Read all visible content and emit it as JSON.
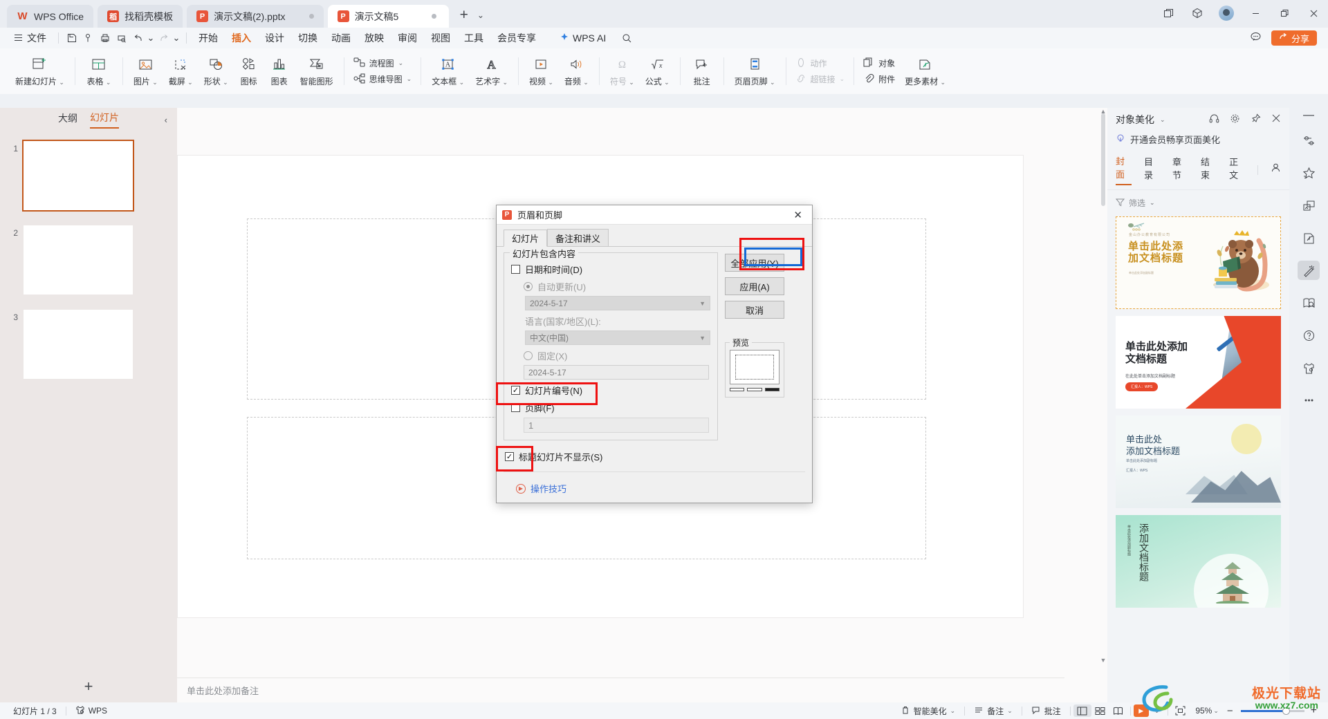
{
  "window": {
    "tabs": [
      {
        "label": "WPS Office",
        "icon": "wps-logo-icon",
        "type": "home"
      },
      {
        "label": "找稻壳模板",
        "icon": "docer-icon",
        "type": "chip"
      },
      {
        "label": "演示文稿(2).pptx",
        "icon": "ppt-icon",
        "type": "chip",
        "modified_dot": true
      },
      {
        "label": "演示文稿5",
        "icon": "ppt-icon",
        "type": "active"
      }
    ],
    "new_tab_icon": "plus-icon",
    "tab_list_icon": "chevron-down-icon",
    "right_icons": [
      "multi-window-icon",
      "cube-icon",
      "avatar"
    ],
    "controls": [
      "minimize-icon",
      "restore-icon",
      "close-icon"
    ]
  },
  "menubar": {
    "file_label": "文件",
    "file_icon": "hamburger-icon",
    "quick_icons": [
      "save-icon",
      "cloud-save-icon",
      "print-icon",
      "print-preview-icon",
      "undo-icon",
      "undo-caret",
      "redo-icon",
      "customize-caret"
    ],
    "items": [
      {
        "label": "开始",
        "active": false
      },
      {
        "label": "插入",
        "active": true
      },
      {
        "label": "设计",
        "active": false
      },
      {
        "label": "切换",
        "active": false
      },
      {
        "label": "动画",
        "active": false
      },
      {
        "label": "放映",
        "active": false
      },
      {
        "label": "审阅",
        "active": false
      },
      {
        "label": "视图",
        "active": false
      },
      {
        "label": "工具",
        "active": false
      },
      {
        "label": "会员专享",
        "active": false
      }
    ],
    "ai_label": "WPS AI",
    "ai_icon": "sparkle-icon",
    "search_icon": "search-icon",
    "feedback_icon": "chat-icon",
    "share_label": "分享",
    "share_icon": "share-icon"
  },
  "ribbon": {
    "groups": [
      {
        "items": [
          {
            "label": "新建幻灯片",
            "icon": "new-slide-icon",
            "caret": true
          }
        ]
      },
      {
        "items": [
          {
            "label": "表格",
            "icon": "table-icon",
            "caret": true
          }
        ]
      },
      {
        "items": [
          {
            "label": "图片",
            "icon": "picture-icon",
            "caret": true
          },
          {
            "label": "截屏",
            "icon": "screenshot-icon",
            "caret": true
          },
          {
            "label": "形状",
            "icon": "shapes-icon",
            "caret": true
          },
          {
            "label": "图标",
            "icon": "icons-icon",
            "caret": false
          },
          {
            "label": "图表",
            "icon": "chart-icon",
            "caret": false
          },
          {
            "label": "智能图形",
            "icon": "smartart-icon",
            "caret": false
          }
        ]
      },
      {
        "stack": [
          {
            "label": "流程图",
            "icon": "flowchart-icon",
            "caret": true
          },
          {
            "label": "思维导图",
            "icon": "mindmap-icon",
            "caret": true
          }
        ]
      },
      {
        "items": [
          {
            "label": "文本框",
            "icon": "textbox-icon",
            "caret": true
          },
          {
            "label": "艺术字",
            "icon": "wordart-icon",
            "caret": true
          }
        ]
      },
      {
        "items": [
          {
            "label": "视频",
            "icon": "video-icon",
            "caret": true
          },
          {
            "label": "音频",
            "icon": "audio-icon",
            "caret": true
          }
        ]
      },
      {
        "items": [
          {
            "label": "符号",
            "icon": "symbol-icon",
            "caret": true,
            "disabled": true
          },
          {
            "label": "公式",
            "icon": "formula-icon",
            "caret": true
          }
        ]
      },
      {
        "items": [
          {
            "label": "批注",
            "icon": "comment-icon",
            "caret": false
          }
        ]
      },
      {
        "items": [
          {
            "label": "页眉页脚",
            "icon": "header-footer-icon",
            "caret": true
          }
        ]
      },
      {
        "stack": [
          {
            "label": "动作",
            "icon": "action-icon",
            "caret": false,
            "disabled": true
          },
          {
            "label": "超链接",
            "icon": "hyperlink-icon",
            "caret": true,
            "disabled": true
          }
        ]
      },
      {
        "stack": [
          {
            "label": "对象",
            "icon": "object-icon",
            "caret": false
          },
          {
            "label": "附件",
            "icon": "attachment-icon",
            "caret": false
          }
        ]
      },
      {
        "items": [
          {
            "label": "更多素材",
            "icon": "more-assets-icon",
            "caret": true
          }
        ]
      }
    ]
  },
  "left_panel": {
    "tabs": [
      {
        "label": "大纲",
        "active": false
      },
      {
        "label": "幻灯片",
        "active": true
      }
    ],
    "collapse_icon": "chevron-left-icon",
    "slides": [
      {
        "number": "1",
        "selected": true
      },
      {
        "number": "2",
        "selected": false
      },
      {
        "number": "3",
        "selected": false
      }
    ],
    "add_slide_icon": "plus-icon"
  },
  "canvas": {
    "notes_placeholder": "单击此处添加备注",
    "scroll_up_icon": "caret-up-icon",
    "scroll_down_icon": "caret-down-icon"
  },
  "right_panel": {
    "title": "对象美化",
    "title_caret": "chevron-down-icon",
    "head_icons": [
      "headset-icon",
      "gear-icon",
      "pin-icon",
      "close-icon"
    ],
    "promo_icon": "lightbulb-icon",
    "promo_text": "开通会员畅享页面美化",
    "tabs": [
      {
        "label": "封面",
        "active": true
      },
      {
        "label": "目录",
        "active": false
      },
      {
        "label": "章节",
        "active": false
      },
      {
        "label": "结束",
        "active": false
      },
      {
        "label": "正文",
        "active": false
      }
    ],
    "person_icon": "person-icon",
    "filter_icon": "filter-icon",
    "filter_label": "筛选",
    "filter_caret": "chevron-down-icon",
    "templates": [
      {
        "id": "bear",
        "subtitle": "金山办公教育有限公司",
        "title": "单击此处添\n加文档标题",
        "footer": "单击此处添加副标题"
      },
      {
        "id": "swoosh",
        "title": "单击此处添加\n文档标题",
        "subtitle": "在此处单击添加文档副标题",
        "badge": "汇报人：WPS"
      },
      {
        "id": "ink",
        "title": "单击此处\n添加文档标题",
        "subtitle": "单击此处添加副标题",
        "footer": "汇报人：WPS"
      },
      {
        "id": "pagoda",
        "title": "添加文档标题",
        "subtitle": "单击此处添加副标题"
      }
    ]
  },
  "rail": {
    "icons": [
      "collapse-dash-icon",
      "properties-icon",
      "favorites-icon",
      "transfer-icon",
      "beautify-doc-icon",
      "magic-wand-icon",
      "find-icon",
      "help-icon",
      "skin-icon",
      "more-icon"
    ],
    "selected_index": 5
  },
  "statusbar": {
    "slide_counter": "幻灯片 1 / 3",
    "wps_label": "WPS",
    "wps_icon": "wps-cloud-icon",
    "smart_beautify": {
      "label": "智能美化",
      "icon": "beautify-icon",
      "caret": true
    },
    "notes": {
      "label": "备注",
      "icon": "notes-icon",
      "caret": true
    },
    "comment": {
      "label": "批注",
      "icon": "comment-icon"
    },
    "views": [
      {
        "icon": "normal-view-icon",
        "selected": true
      },
      {
        "icon": "slide-sorter-icon",
        "selected": false
      },
      {
        "icon": "reading-view-icon",
        "selected": false
      }
    ],
    "play": {
      "icon": "play-icon",
      "caret": true
    },
    "fit_icon": "fit-to-window-icon",
    "zoom_label": "95%",
    "zoom_caret": "chevron-down-icon",
    "zoom_minus": "−",
    "zoom_plus": "+"
  },
  "watermark": {
    "line1": "极光下载站",
    "line2": "www.xz7.com",
    "logo": "swirl-logo-icon"
  },
  "dialog": {
    "title": "页眉和页脚",
    "icon": "ppt-icon",
    "close_icon": "close-icon",
    "tabs": [
      {
        "label": "幻灯片",
        "active": true
      },
      {
        "label": "备注和讲义",
        "active": false
      }
    ],
    "group_legend": "幻灯片包含内容",
    "date_time": {
      "label": "日期和时间(D)",
      "checked": false
    },
    "auto_update": {
      "label": "自动更新(U)",
      "selected": true,
      "disabled": true,
      "value": "2024-5-17",
      "caret": "chevron-down-icon"
    },
    "language": {
      "label": "语言(国家/地区)(L):",
      "value": "中文(中国)",
      "caret": "chevron-down-icon"
    },
    "fixed": {
      "label": "固定(X)",
      "selected": false,
      "disabled": true,
      "value": "2024-5-17"
    },
    "slide_number": {
      "label": "幻灯片编号(N)",
      "checked": true,
      "highlighted": true
    },
    "footer": {
      "label": "页脚(F)",
      "checked": false,
      "value": "1"
    },
    "no_title_slide": {
      "label": "标题幻灯片不显示(S)",
      "checked": true,
      "highlighted": true
    },
    "buttons": [
      {
        "label": "全部应用(Y)",
        "name": "apply-all",
        "highlighted": true
      },
      {
        "label": "应用(A)",
        "name": "apply",
        "highlighted": false
      },
      {
        "label": "取消",
        "name": "cancel",
        "highlighted": false
      }
    ],
    "preview_legend": "预览",
    "tips_label": "操作技巧",
    "tips_icon": "tips-icon"
  },
  "colors": {
    "accent_orange": "#e06a20",
    "share_orange": "#ef6c2c",
    "anno_red": "#ee1111",
    "anno_blue": "#1469d6",
    "selected_slide_border": "#c2571a"
  }
}
